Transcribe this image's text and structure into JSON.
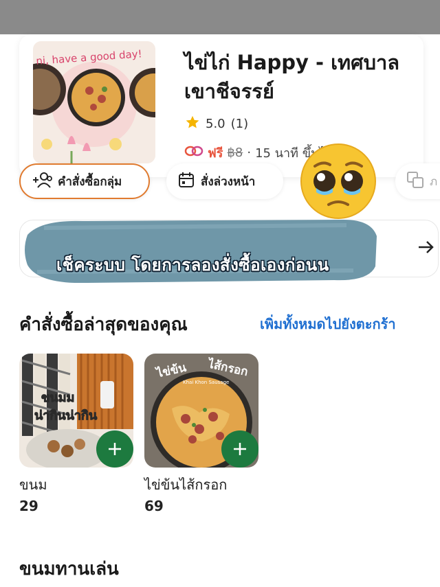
{
  "store": {
    "banner_text": "ni, have a good day!",
    "name": "ไข่ไก่ Happy - เทศบาลเขาชีจรรย์",
    "rating": "5.0",
    "rating_count": "(1)",
    "delivery_free": "ฟรี",
    "delivery_old_fee": "฿8",
    "delivery_separator": "·",
    "delivery_time": "15 นาที ขึ้นไป"
  },
  "chips": {
    "group_order": "คำสั่งซื้อกลุ่ม",
    "schedule_order": "สั่งล่วงหน้า",
    "translate": "ภ"
  },
  "overlay": {
    "text": "เช็คระบบ โดยการลองสั่งซื้อเองก่อนน"
  },
  "recent": {
    "title": "คำสั่งซื้อล่าสุดของคุณ",
    "add_all_link": "เพิ่มทั้งหมดไปยังตะกร้า",
    "items": [
      {
        "name": "ขนม",
        "price": "29",
        "img_label_1": "ขนมม",
        "img_label_2": "น่ากินน่ากิน"
      },
      {
        "name": "ไข่ข้นไส้กรอก",
        "price": "69",
        "img_label_1": "ไข่ข้น",
        "img_label_2": "ไส้กรอก",
        "img_sub": "Khai Khon Sausage"
      }
    ]
  },
  "next_section": {
    "title": "ขนมทานเล่น"
  },
  "colors": {
    "accent_orange": "#e07a2e",
    "link_blue": "#1f6fd1",
    "add_green": "#1d7a3f",
    "free_red": "#e8553e",
    "paint_blue": "#6f97a8"
  }
}
